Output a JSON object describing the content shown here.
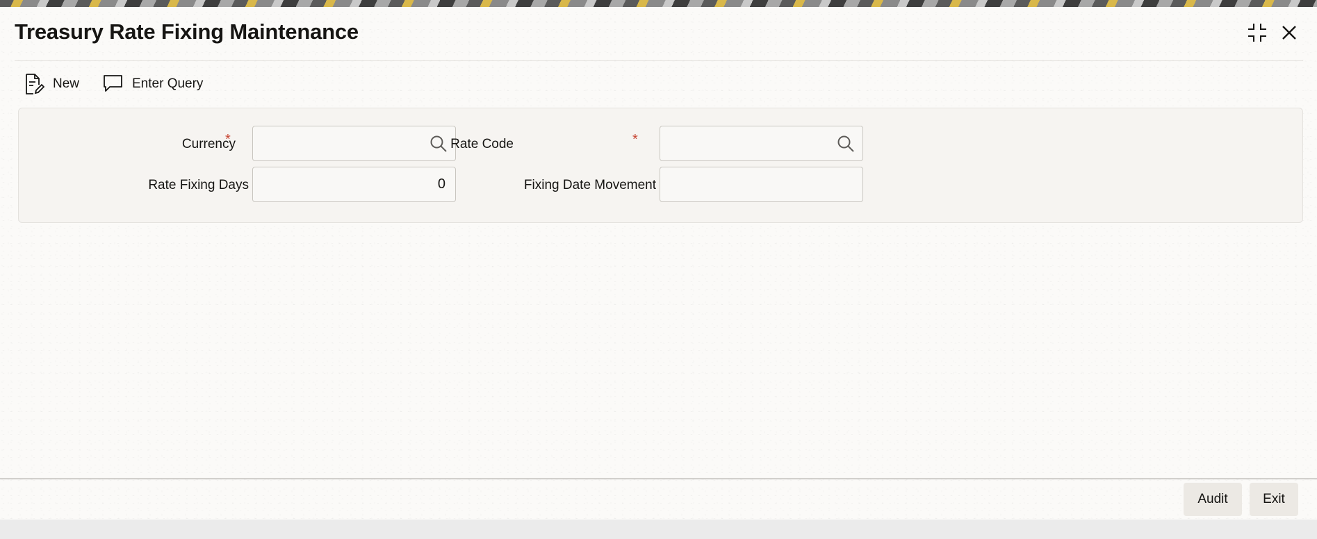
{
  "window": {
    "title": "Treasury Rate Fixing Maintenance",
    "icons": {
      "maximize": "collapse-icon",
      "close": "close-icon"
    }
  },
  "toolbar": {
    "new_label": "New",
    "new_icon": "new-document-icon",
    "query_label": "Enter Query",
    "query_icon": "chat-bubble-icon"
  },
  "form": {
    "currency": {
      "label": "Currency",
      "required": "*",
      "value": ""
    },
    "rate_code": {
      "label": "Rate Code",
      "required": "*",
      "value": ""
    },
    "rate_fixing_days": {
      "label": "Rate Fixing Days",
      "value": "0"
    },
    "fixing_date_movement": {
      "label": "Fixing Date Movement",
      "value": ""
    }
  },
  "footer": {
    "audit_label": "Audit",
    "exit_label": "Exit"
  },
  "colors": {
    "required": "#c74634",
    "text": "#161513",
    "panel": "#f6f4f1"
  }
}
